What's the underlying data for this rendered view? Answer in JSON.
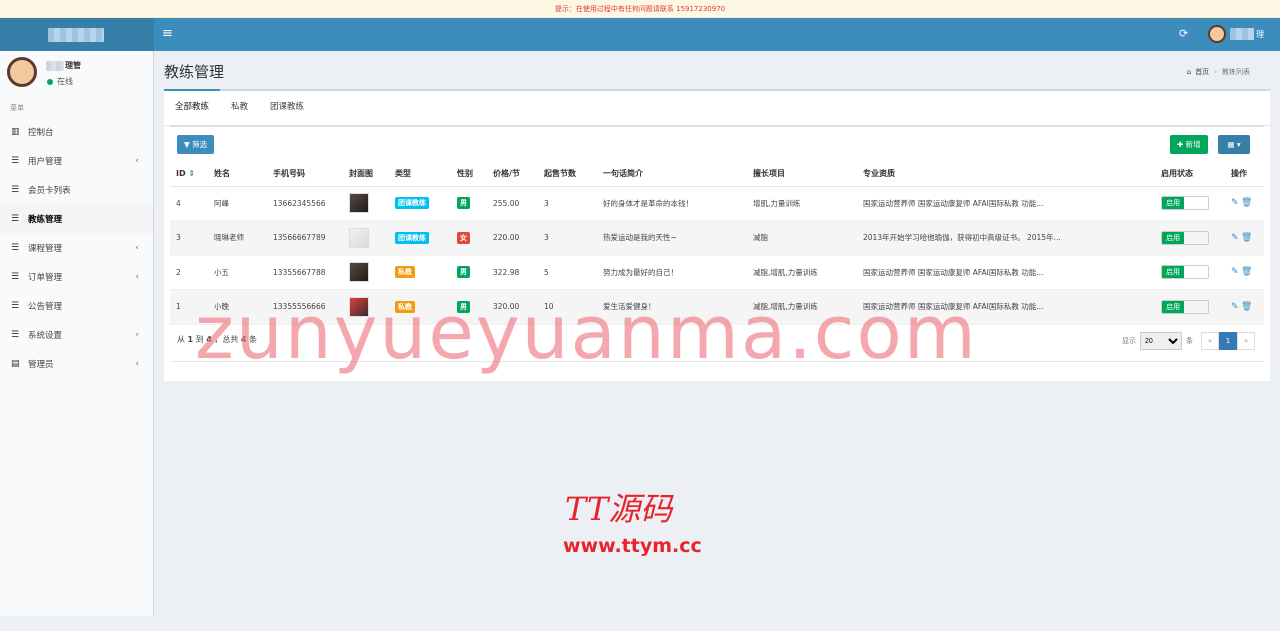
{
  "notice": "提示：在使用过程中有任何问题请联系 15917230970",
  "topbar": {
    "user_suffix": "理"
  },
  "sidebar": {
    "user_suffix": "理管",
    "status": "在线",
    "header": "菜单",
    "items": [
      {
        "label": "控制台",
        "icon": "bar-chart-icon",
        "chev": ""
      },
      {
        "label": "用户管理",
        "icon": "list-icon",
        "chev": "‹"
      },
      {
        "label": "会员卡列表",
        "icon": "list-icon",
        "chev": ""
      },
      {
        "label": "教练管理",
        "icon": "list-icon",
        "chev": ""
      },
      {
        "label": "课程管理",
        "icon": "list-icon",
        "chev": "‹"
      },
      {
        "label": "订单管理",
        "icon": "list-icon",
        "chev": "‹"
      },
      {
        "label": "公告管理",
        "icon": "list-icon",
        "chev": ""
      },
      {
        "label": "系统设置",
        "icon": "list-icon",
        "chev": "‹"
      },
      {
        "label": "管理员",
        "icon": "admin-icon",
        "chev": "‹"
      }
    ]
  },
  "page": {
    "title": "教练管理",
    "breadcrumb": {
      "home": "首页",
      "current": "教练列表"
    }
  },
  "tabs": [
    "全部教练",
    "私教",
    "团课教练"
  ],
  "toolbar": {
    "filter": "筛选",
    "add": "新增"
  },
  "table": {
    "headers": [
      "ID",
      "姓名",
      "手机号码",
      "封面图",
      "类型",
      "性别",
      "价格/节",
      "起售节数",
      "一句话简介",
      "擅长项目",
      "专业资质",
      "启用状态",
      "操作"
    ],
    "rows": [
      {
        "id": "4",
        "name": "阿峰",
        "phone": "13662345566",
        "type": "团课教练",
        "gender": "男",
        "price": "255.00",
        "min": "3",
        "intro": "好的身体才是革命的本钱！",
        "skill": "增肌,力量训练",
        "qual": "国家运动营养师 国家运动康复师 AFAI国际私教 功能...",
        "status": "启用"
      },
      {
        "id": "3",
        "name": "晓琳老师",
        "phone": "13566667789",
        "type": "团课教练",
        "gender": "女",
        "price": "220.00",
        "min": "3",
        "intro": "热爱运动是我的天性~",
        "skill": "减脂",
        "qual": "2013年开始学习哈他瑜伽，获得初中高级证书。 2015年...",
        "status": "启用"
      },
      {
        "id": "2",
        "name": "小五",
        "phone": "13355667788",
        "type": "私教",
        "gender": "男",
        "price": "322.98",
        "min": "5",
        "intro": "努力成为最好的自己！",
        "skill": "减脂,增肌,力量训练",
        "qual": "国家运动营养师 国家运动康复师 AFAI国际私教 功能...",
        "status": "启用"
      },
      {
        "id": "1",
        "name": "小晚",
        "phone": "13355556666",
        "type": "私教",
        "gender": "男",
        "price": "320.00",
        "min": "10",
        "intro": "爱生活爱健身！",
        "skill": "减脂,增肌,力量训练",
        "qual": "国家运动营养师 国家运动康复师 AFAI国际私教 功能...",
        "status": "启用"
      }
    ]
  },
  "footer": {
    "info_pre": "从 ",
    "from": "1",
    "info_mid1": " 到 ",
    "to": "4",
    "info_mid2": " ，总共 ",
    "total": "4",
    "info_post": " 条",
    "show": "显示",
    "per_page": "20",
    "unit": "条",
    "prev": "«",
    "page": "1",
    "next": "»"
  },
  "watermarks": {
    "main": "zunyueyuanma.com",
    "brand": "TT源码",
    "url": "www.ttym.cc"
  }
}
